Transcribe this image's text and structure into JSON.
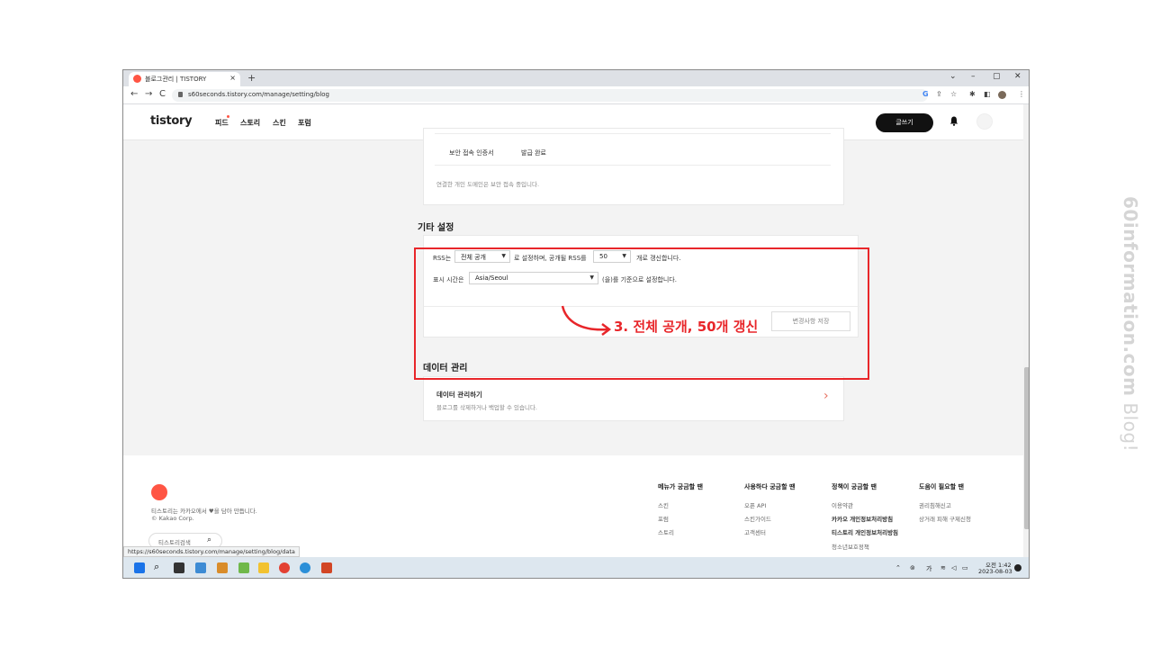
{
  "browser": {
    "tab_title": "블로그관리 | TISTORY",
    "tab_close": "×",
    "new_tab": "+",
    "url": "s60seconds.tistory.com/manage/setting/blog",
    "status_url": "https://s60seconds.tistory.com/manage/setting/blog/data",
    "window_controls": [
      "⌄",
      "–",
      "▢",
      "✕"
    ]
  },
  "nav": {
    "logo": "tistory",
    "menu": [
      "피드",
      "스토리",
      "스킨",
      "포럼"
    ],
    "write_label": "글쓰기"
  },
  "security": {
    "row_label": "보안 접속 인증서",
    "row_value": "발급 완료",
    "note": "연결한 개인 도메인은 보안 접속 중입니다."
  },
  "other_settings": {
    "title": "기타 설정",
    "rss_prefix": "RSS는",
    "rss_visibility": "전체 공개",
    "rss_middle": "로 설정하며, 공개될 RSS를",
    "rss_count": "50",
    "rss_suffix": "개로 갱신합니다.",
    "time_prefix": "표시 시간은",
    "timezone": "Asia/Seoul",
    "time_suffix": "(을)를 기준으로 설정합니다.",
    "save_label": "변경사항 저장"
  },
  "annotation": "3. 전체 공개, 50개 갱신",
  "data_management": {
    "title": "데이터 관리",
    "item_title": "데이터 관리하기",
    "item_desc": "블로그를 삭제하거나 백업할 수 있습니다."
  },
  "footer": {
    "tagline": "티스토리는 카카오에서 ♥을 담아 만듭니다.",
    "copyright": "© Kakao Corp.",
    "search_placeholder": "티스토리검색",
    "columns": [
      {
        "title": "메뉴가 궁금할 땐",
        "links": [
          "스킨",
          "포럼",
          "스토리"
        ]
      },
      {
        "title": "사용하다 궁금할 땐",
        "links": [
          "오픈 API",
          "스킨가이드",
          "고객센터"
        ]
      },
      {
        "title": "정책이 궁금할 땐",
        "links": [
          "이용약관",
          "카카오 개인정보처리방침",
          "티스토리 개인정보처리방침",
          "청소년보호정책"
        ]
      },
      {
        "title": "도움이 필요할 땐",
        "links": [
          "권리침해신고",
          "상거래 피해 구제신청"
        ]
      }
    ]
  },
  "taskbar": {
    "time": "오전 1:42",
    "date": "2023-08-03",
    "ime": "가"
  },
  "watermark": {
    "main": "60information.com",
    "suffix": " Blog!"
  }
}
